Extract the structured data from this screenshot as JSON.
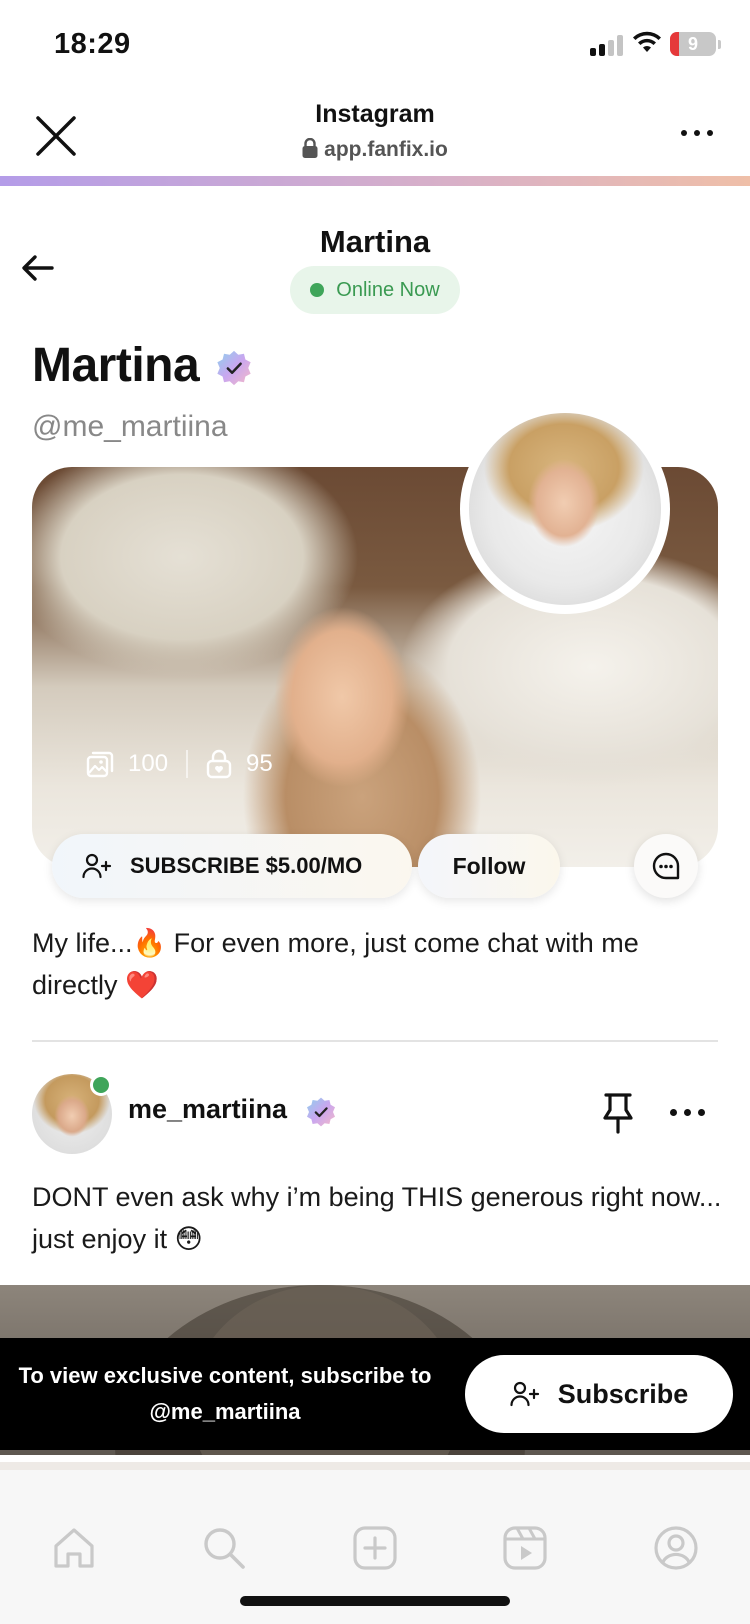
{
  "status_bar": {
    "time": "18:29",
    "battery": "9",
    "battery_color": "#e5393a"
  },
  "browser": {
    "title": "Instagram",
    "url": "app.fanfix.io"
  },
  "page": {
    "title": "Martina",
    "online_label": "Online Now",
    "online_color": "#3fa55a"
  },
  "profile": {
    "name": "Martina",
    "handle": "@me_martiina",
    "media_count": "100",
    "locked_count": "95",
    "subscribe_label": "SUBSCRIBE $5.00/MO",
    "follow_label": "Follow",
    "bio": "My life...🔥 For even more, just come chat with me directly ❤️"
  },
  "post": {
    "username": "me_martiina",
    "text": "DONT even ask why i’m being THIS generous right now... just enjoy it 😳"
  },
  "banner": {
    "text": "To view exclusive content, subscribe to @me_martiina",
    "button_label": "Subscribe"
  },
  "tabs": [
    "home-icon",
    "search-icon",
    "create-icon",
    "reels-icon",
    "profile-icon"
  ]
}
